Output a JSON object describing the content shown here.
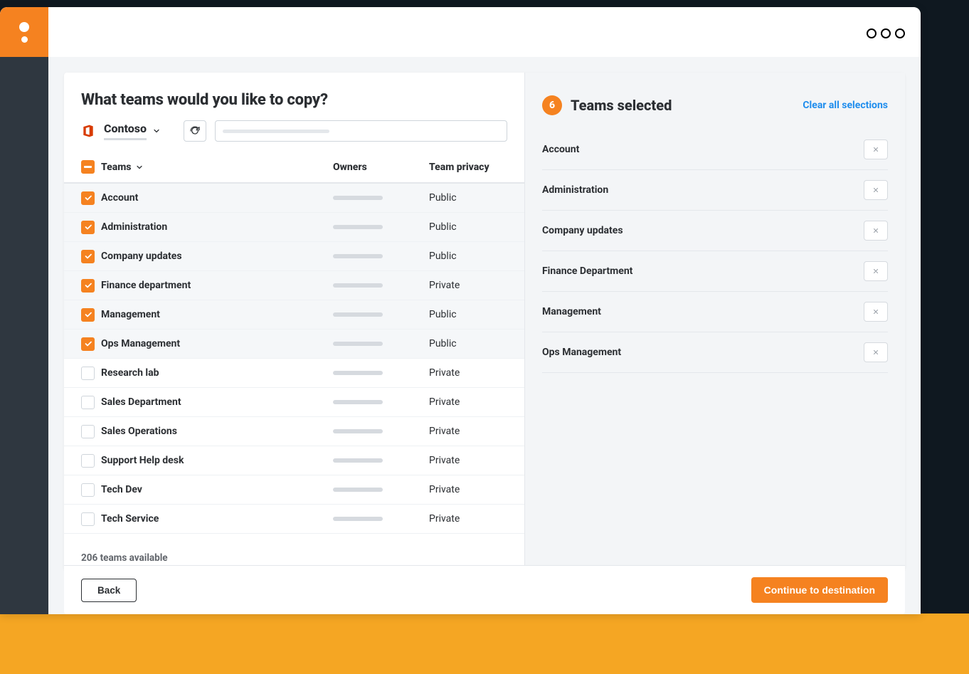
{
  "heading": "What teams would you like to copy?",
  "tenant": {
    "name": "Contoso"
  },
  "columns": {
    "teams": "Teams",
    "owners": "Owners",
    "privacy": "Team privacy"
  },
  "teams": [
    {
      "name": "Account",
      "privacy": "Public",
      "checked": true
    },
    {
      "name": "Administration",
      "privacy": "Public",
      "checked": true
    },
    {
      "name": "Company updates",
      "privacy": "Public",
      "checked": true
    },
    {
      "name": "Finance department",
      "privacy": "Private",
      "checked": true
    },
    {
      "name": "Management",
      "privacy": "Public",
      "checked": true
    },
    {
      "name": "Ops Management",
      "privacy": "Public",
      "checked": true
    },
    {
      "name": "Research lab",
      "privacy": "Private",
      "checked": false
    },
    {
      "name": "Sales Department",
      "privacy": "Private",
      "checked": false
    },
    {
      "name": "Sales Operations",
      "privacy": "Private",
      "checked": false
    },
    {
      "name": "Support Help desk",
      "privacy": "Private",
      "checked": false
    },
    {
      "name": "Tech Dev",
      "privacy": "Private",
      "checked": false
    },
    {
      "name": "Tech Service",
      "privacy": "Private",
      "checked": false
    }
  ],
  "status": "206 teams available",
  "selected": {
    "count": 6,
    "title": "Teams selected",
    "clear": "Clear all selections",
    "items": [
      "Account",
      "Administration",
      "Company updates",
      "Finance Department",
      "Management",
      "Ops Management"
    ]
  },
  "buttons": {
    "back": "Back",
    "continue": "Continue to destination"
  }
}
